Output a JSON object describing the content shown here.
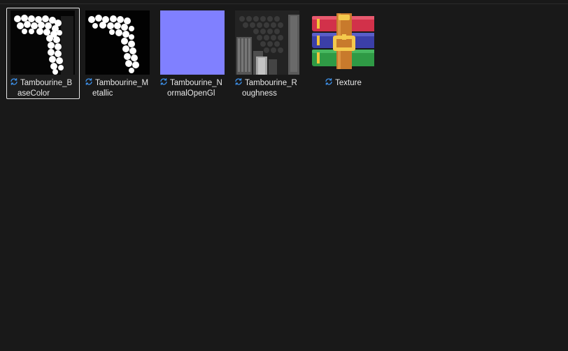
{
  "files": [
    {
      "name_line1": "Tambourine_B",
      "name_line2": "aseColor",
      "selected": true,
      "kind": "basecolor",
      "sync_icon": "sync-icon"
    },
    {
      "name_line1": "Tambourine_M",
      "name_line2": "etallic",
      "selected": false,
      "kind": "metallic",
      "sync_icon": "sync-icon"
    },
    {
      "name_line1": "Tambourine_N",
      "name_line2": "ormalOpenGl",
      "selected": false,
      "kind": "normal",
      "sync_icon": "sync-icon"
    },
    {
      "name_line1": "Tambourine_R",
      "name_line2": "oughness",
      "selected": false,
      "kind": "roughness",
      "sync_icon": "sync-icon"
    },
    {
      "name_line1": "Texture",
      "name_line2": "",
      "selected": false,
      "kind": "archive",
      "sync_icon": "sync-icon"
    }
  ],
  "colors": {
    "background": "#191919",
    "selection_border": "#e6e6e6",
    "sync_blue": "#3c8ee6",
    "normal_map": "#8080ff"
  }
}
